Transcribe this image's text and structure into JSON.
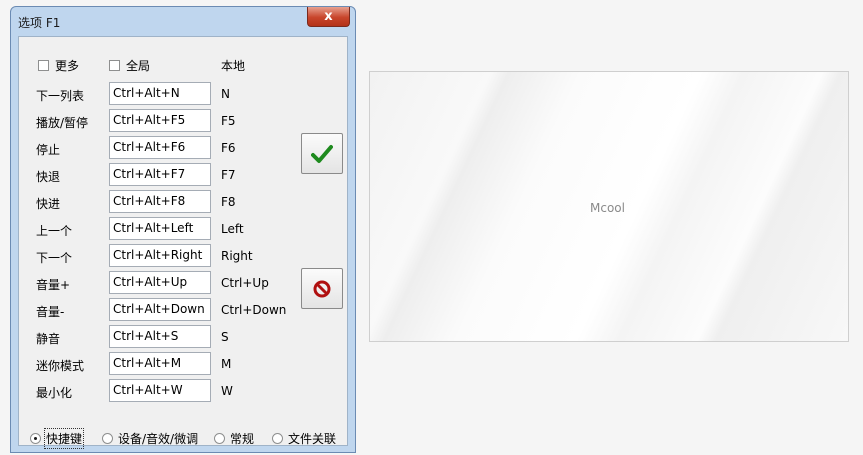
{
  "window": {
    "title": "选项 F1",
    "close_label": "x"
  },
  "top_options": {
    "more_label": "更多",
    "global_label": "全局",
    "local_label": "本地"
  },
  "hotkeys": [
    {
      "label": "下一列表",
      "global": "Ctrl+Alt+N",
      "local": "N"
    },
    {
      "label": "播放/暂停",
      "global": "Ctrl+Alt+F5",
      "local": "F5"
    },
    {
      "label": "停止",
      "global": "Ctrl+Alt+F6",
      "local": "F6"
    },
    {
      "label": "快退",
      "global": "Ctrl+Alt+F7",
      "local": "F7"
    },
    {
      "label": "快进",
      "global": "Ctrl+Alt+F8",
      "local": "F8"
    },
    {
      "label": "上一个",
      "global": "Ctrl+Alt+Left",
      "local": "Left"
    },
    {
      "label": "下一个",
      "global": "Ctrl+Alt+Right",
      "local": "Right"
    },
    {
      "label": "音量+",
      "global": "Ctrl+Alt+Up",
      "local": "Ctrl+Up"
    },
    {
      "label": "音量-",
      "global": "Ctrl+Alt+Down",
      "local": "Ctrl+Down"
    },
    {
      "label": "静音",
      "global": "Ctrl+Alt+S",
      "local": "S"
    },
    {
      "label": "迷你模式",
      "global": "Ctrl+Alt+M",
      "local": "M"
    },
    {
      "label": "最小化",
      "global": "Ctrl+Alt+W",
      "local": "W"
    }
  ],
  "buttons": {
    "ok_icon": "check-icon",
    "cancel_icon": "no-entry-icon"
  },
  "tabs": [
    {
      "label": "快捷键",
      "selected": true
    },
    {
      "label": "设备/音效/微调",
      "selected": false
    },
    {
      "label": "常规",
      "selected": false
    },
    {
      "label": "文件关联",
      "selected": false
    }
  ],
  "preview": {
    "logo_text": "Mcool"
  },
  "colors": {
    "check_green": "#1e8a1e",
    "stop_red": "#b01010",
    "close_red": "#c8452b"
  }
}
